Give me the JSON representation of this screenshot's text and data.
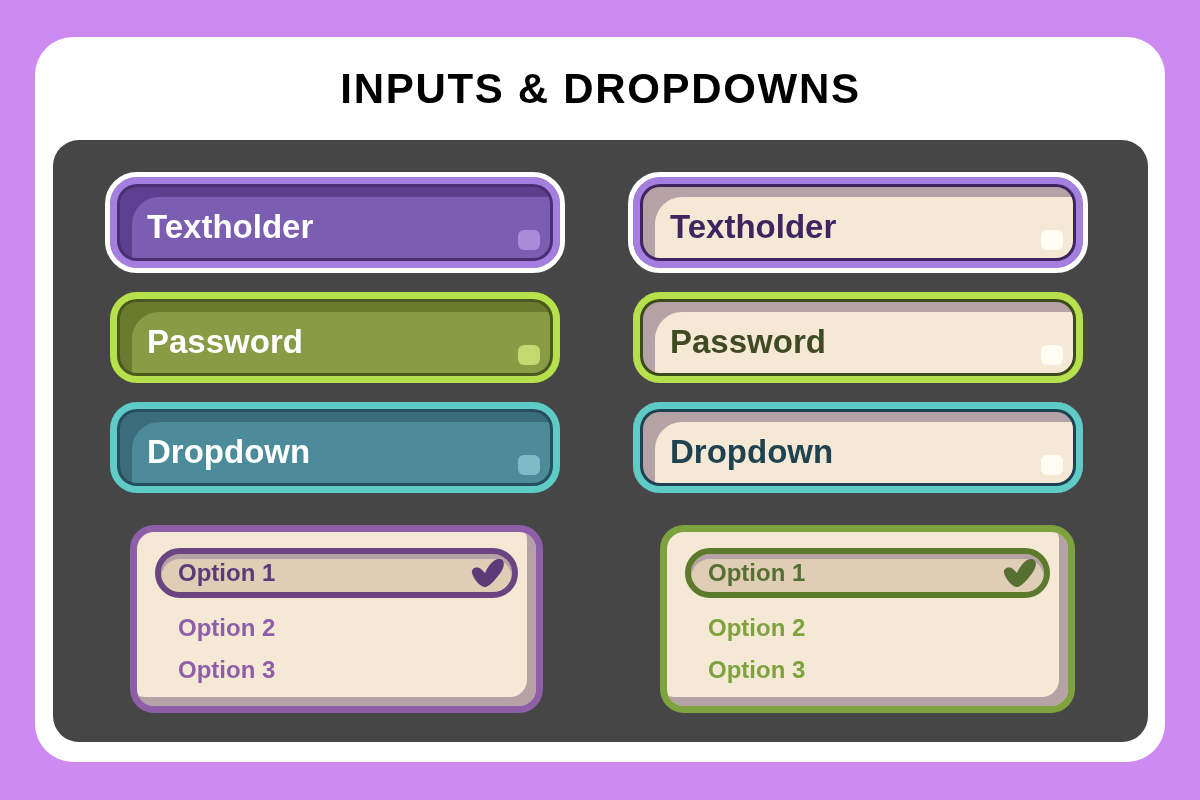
{
  "title": "INPUTS & DROPDOWNS",
  "columns": [
    {
      "kind": "filled",
      "fields": [
        {
          "placeholder": "Textholder",
          "focused": true,
          "color": "#a47fe0"
        },
        {
          "placeholder": "Password",
          "focused": false,
          "color": "#b6e04c"
        },
        {
          "placeholder": "Dropdown",
          "focused": false,
          "color": "#5ecbc7"
        }
      ],
      "dropdown": {
        "color": "#8e5fa8",
        "options": [
          {
            "label": "Option 1",
            "selected": true
          },
          {
            "label": "Option 2",
            "selected": false
          },
          {
            "label": "Option 3",
            "selected": false
          }
        ]
      }
    },
    {
      "kind": "light",
      "fields": [
        {
          "placeholder": "Textholder",
          "focused": true,
          "color": "#a47fe0"
        },
        {
          "placeholder": "Password",
          "focused": false,
          "color": "#b6e04c"
        },
        {
          "placeholder": "Dropdown",
          "focused": false,
          "color": "#5ecbc7"
        }
      ],
      "dropdown": {
        "color": "#7ea23e",
        "options": [
          {
            "label": "Option 1",
            "selected": true
          },
          {
            "label": "Option 2",
            "selected": false
          },
          {
            "label": "Option 3",
            "selected": false
          }
        ]
      }
    }
  ]
}
